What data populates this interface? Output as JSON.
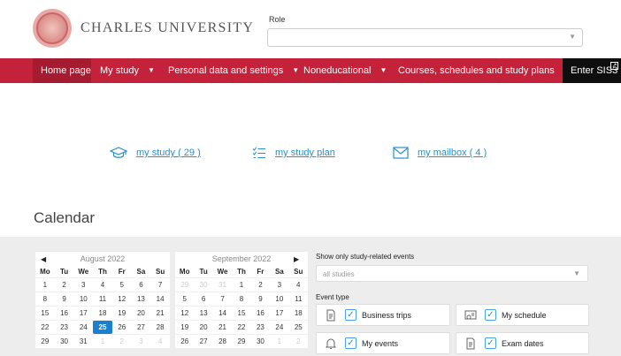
{
  "header": {
    "university_name": "CHARLES UNIVERSITY",
    "role_label": "Role",
    "role_value": ""
  },
  "nav": {
    "home": "Home page",
    "my_study": "My study",
    "personal": "Personal data and settings",
    "noneducational": "Noneducational",
    "courses": "Courses, schedules and study plans",
    "enter_sis3": "Enter SIS3"
  },
  "quick_links": {
    "my_study": "my study ( 29 )",
    "my_study_plan": "my study plan",
    "my_mailbox": "my mailbox ( 4 )"
  },
  "calendar": {
    "title": "Calendar",
    "weekdays": [
      "Mo",
      "Tu",
      "We",
      "Th",
      "Fr",
      "Sa",
      "Su"
    ],
    "months": [
      {
        "name": "August 2022",
        "weeks": [
          [
            "1",
            "2",
            "3",
            "4",
            "5",
            "6",
            "7"
          ],
          [
            "8",
            "9",
            "10",
            "11",
            "12",
            "13",
            "14"
          ],
          [
            "15",
            "16",
            "17",
            "18",
            "19",
            "20",
            "21"
          ],
          [
            "22",
            "23",
            "24",
            "25",
            "26",
            "27",
            "28"
          ],
          [
            "29",
            "30",
            "31",
            "1",
            "2",
            "3",
            "4"
          ]
        ],
        "today": "25"
      },
      {
        "name": "September 2022",
        "weeks": [
          [
            "29",
            "30",
            "31",
            "1",
            "2",
            "3",
            "4"
          ],
          [
            "5",
            "6",
            "7",
            "8",
            "9",
            "10",
            "11"
          ],
          [
            "12",
            "13",
            "14",
            "15",
            "16",
            "17",
            "18"
          ],
          [
            "19",
            "20",
            "21",
            "22",
            "23",
            "24",
            "25"
          ],
          [
            "26",
            "27",
            "28",
            "29",
            "30",
            "1",
            "2"
          ]
        ]
      }
    ]
  },
  "filters": {
    "study_events_label": "Show only study-related events",
    "study_events_placeholder": "all studies",
    "event_type_label": "Event type",
    "event_types": [
      {
        "label": "Business trips",
        "checked": true,
        "icon": "document-icon"
      },
      {
        "label": "My schedule",
        "checked": true,
        "icon": "schedule-icon"
      },
      {
        "label": "My events",
        "checked": true,
        "icon": "bell-icon"
      },
      {
        "label": "Exam dates",
        "checked": true,
        "icon": "document-icon"
      }
    ]
  },
  "colors": {
    "nav_red": "#c4213a",
    "nav_active": "#a51b30",
    "link_blue": "#2a8fc9",
    "today_blue": "#1a7fd0"
  }
}
